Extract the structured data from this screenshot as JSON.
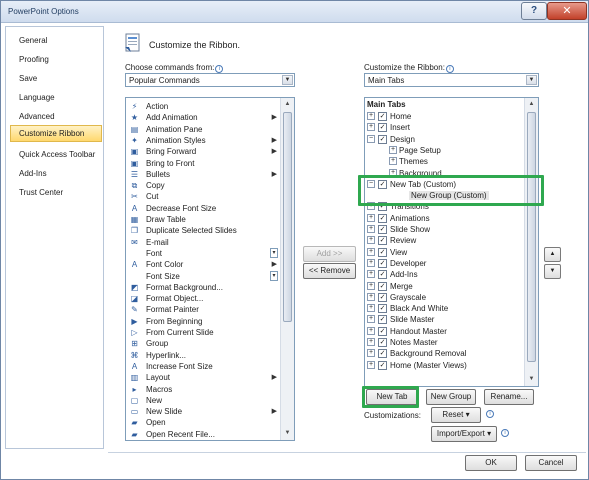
{
  "window": {
    "title": "PowerPoint Options",
    "help_glyph": "?",
    "close_glyph": "✕"
  },
  "nav": {
    "items": [
      {
        "label": "General",
        "selected": false
      },
      {
        "label": "Proofing",
        "selected": false
      },
      {
        "label": "Save",
        "selected": false
      },
      {
        "label": "Language",
        "selected": false
      },
      {
        "label": "Advanced",
        "selected": false
      },
      {
        "label": "Customize Ribbon",
        "selected": true
      },
      {
        "label": "Quick Access Toolbar",
        "selected": false
      },
      {
        "label": "Add-Ins",
        "selected": false
      },
      {
        "label": "Trust Center",
        "selected": false
      }
    ]
  },
  "header": {
    "title": "Customize the Ribbon."
  },
  "left_panel": {
    "label": "Choose commands from:",
    "combo_value": "Popular Commands",
    "commands": [
      {
        "label": "Action",
        "icon": "⚡",
        "suffix": ""
      },
      {
        "label": "Add Animation",
        "icon": "★",
        "suffix": "▶"
      },
      {
        "label": "Animation Pane",
        "icon": "▤",
        "suffix": ""
      },
      {
        "label": "Animation Styles",
        "icon": "✦",
        "suffix": "▶"
      },
      {
        "label": "Bring Forward",
        "icon": "▣",
        "suffix": "▶"
      },
      {
        "label": "Bring to Front",
        "icon": "▣",
        "suffix": ""
      },
      {
        "label": "Bullets",
        "icon": "☰",
        "suffix": "▶"
      },
      {
        "label": "Copy",
        "icon": "⧉",
        "suffix": ""
      },
      {
        "label": "Cut",
        "icon": "✂",
        "suffix": ""
      },
      {
        "label": "Decrease Font Size",
        "icon": "A",
        "suffix": ""
      },
      {
        "label": "Draw Table",
        "icon": "▦",
        "suffix": ""
      },
      {
        "label": "Duplicate Selected Slides",
        "icon": "❐",
        "suffix": ""
      },
      {
        "label": "E-mail",
        "icon": "✉",
        "suffix": ""
      },
      {
        "label": "Font",
        "icon": "",
        "suffix": "split"
      },
      {
        "label": "Font Color",
        "icon": "A",
        "suffix": "▶"
      },
      {
        "label": "Font Size",
        "icon": "",
        "suffix": "split"
      },
      {
        "label": "Format Background...",
        "icon": "◩",
        "suffix": ""
      },
      {
        "label": "Format Object...",
        "icon": "◪",
        "suffix": ""
      },
      {
        "label": "Format Painter",
        "icon": "✎",
        "suffix": ""
      },
      {
        "label": "From Beginning",
        "icon": "▶",
        "suffix": ""
      },
      {
        "label": "From Current Slide",
        "icon": "▷",
        "suffix": ""
      },
      {
        "label": "Group",
        "icon": "⊞",
        "suffix": ""
      },
      {
        "label": "Hyperlink...",
        "icon": "⌘",
        "suffix": ""
      },
      {
        "label": "Increase Font Size",
        "icon": "A",
        "suffix": ""
      },
      {
        "label": "Layout",
        "icon": "▥",
        "suffix": "▶"
      },
      {
        "label": "Macros",
        "icon": "▸",
        "suffix": ""
      },
      {
        "label": "New",
        "icon": "▢",
        "suffix": ""
      },
      {
        "label": "New Slide",
        "icon": "▭",
        "suffix": "▶"
      },
      {
        "label": "Open",
        "icon": "▰",
        "suffix": ""
      },
      {
        "label": "Open Recent File...",
        "icon": "▰",
        "suffix": ""
      }
    ],
    "split_glyph": "▾"
  },
  "middle": {
    "add_label": "Add >>",
    "remove_label": "<< Remove"
  },
  "right_panel": {
    "label": "Customize the Ribbon:",
    "combo_value": "Main Tabs",
    "tree_header": "Main Tabs",
    "nodes": [
      {
        "label": "Home",
        "level": 0,
        "expander": "+",
        "checked": true
      },
      {
        "label": "Insert",
        "level": 0,
        "expander": "+",
        "checked": true
      },
      {
        "label": "Design",
        "level": 0,
        "expander": "−",
        "checked": true
      },
      {
        "label": "Page Setup",
        "level": 1,
        "expander": "+",
        "checked": null
      },
      {
        "label": "Themes",
        "level": 1,
        "expander": "+",
        "checked": null
      },
      {
        "label": "Background",
        "level": 1,
        "expander": "+",
        "checked": null
      },
      {
        "label": "New Tab (Custom)",
        "level": 0,
        "expander": "−",
        "checked": true
      },
      {
        "label": "New Group (Custom)",
        "level": 2,
        "expander": "",
        "checked": null,
        "selected": true
      },
      {
        "label": "Transitions",
        "level": 0,
        "expander": "+",
        "checked": true
      },
      {
        "label": "Animations",
        "level": 0,
        "expander": "+",
        "checked": true
      },
      {
        "label": "Slide Show",
        "level": 0,
        "expander": "+",
        "checked": true
      },
      {
        "label": "Review",
        "level": 0,
        "expander": "+",
        "checked": true
      },
      {
        "label": "View",
        "level": 0,
        "expander": "+",
        "checked": true
      },
      {
        "label": "Developer",
        "level": 0,
        "expander": "+",
        "checked": true
      },
      {
        "label": "Add-Ins",
        "level": 0,
        "expander": "+",
        "checked": true
      },
      {
        "label": "Merge",
        "level": 0,
        "expander": "+",
        "checked": true
      },
      {
        "label": "Grayscale",
        "level": 0,
        "expander": "+",
        "checked": true
      },
      {
        "label": "Black And White",
        "level": 0,
        "expander": "+",
        "checked": true
      },
      {
        "label": "Slide Master",
        "level": 0,
        "expander": "+",
        "checked": true
      },
      {
        "label": "Handout Master",
        "level": 0,
        "expander": "+",
        "checked": true
      },
      {
        "label": "Notes Master",
        "level": 0,
        "expander": "+",
        "checked": true
      },
      {
        "label": "Background Removal",
        "level": 0,
        "expander": "+",
        "checked": true
      },
      {
        "label": "Home (Master Views)",
        "level": 0,
        "expander": "+",
        "checked": true
      }
    ],
    "check_glyph": "✓",
    "new_tab_label": "New Tab",
    "new_group_label": "New Group",
    "rename_label": "Rename...",
    "customizations_label": "Customizations:",
    "reset_label": "Reset",
    "import_export_label": "Import/Export",
    "move_up_glyph": "▲",
    "move_down_glyph": "▼"
  },
  "footer": {
    "ok_label": "OK",
    "cancel_label": "Cancel"
  },
  "colors": {
    "highlight": "#2fa84f",
    "selected_nav": "#ffd86e",
    "title_bar": "#cfdcee"
  }
}
